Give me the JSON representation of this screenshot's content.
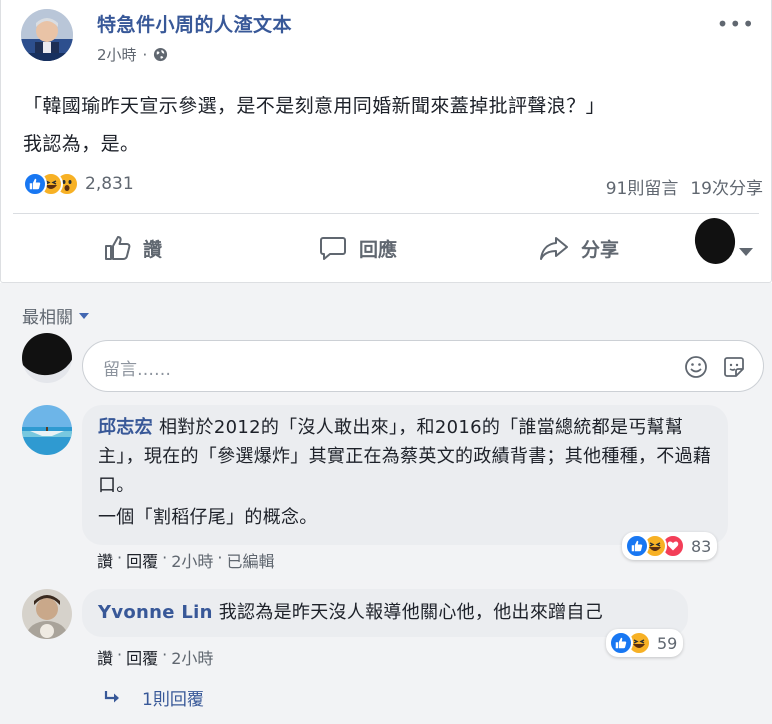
{
  "post": {
    "page_name": "特急件小周的人渣文本",
    "time": "2小時",
    "line1": "「韓國瑜昨天宣示參選，是不是刻意用同婚新聞來蓋掉批評聲浪？」",
    "line2": "我認為，是。",
    "reaction_count": "2,831",
    "comments_count": "91則留言",
    "shares_count": "19次分享",
    "reaction_icons": [
      "like-icon",
      "haha-icon",
      "wow-icon"
    ]
  },
  "actions": {
    "like": "讚",
    "comment": "回應",
    "share": "分享"
  },
  "sort_label": "最相關",
  "comment_input": {
    "placeholder": "留言……"
  },
  "comments": [
    {
      "author": "邱志宏",
      "text1": "相對於2012的「沒人敢出來」，和2016的「誰當總統都是丐幫幫主」，現在的「參選爆炸」其實正在為蔡英文的政績背書；其他種種，不過藉口。",
      "text2": "一個「割稻仔尾」的概念。",
      "like": "讚",
      "reply": "回覆",
      "time": "2小時",
      "edited": "已編輯",
      "reaction_count": "83",
      "reaction_icons": [
        "like-icon",
        "haha-icon",
        "love-icon"
      ]
    },
    {
      "author": "Yvonne Lin",
      "text": "我認為是昨天沒人報導他關心他，他出來蹭自己",
      "like": "讚",
      "reply": "回覆",
      "time": "2小時",
      "reaction_count": "59",
      "reaction_icons": [
        "like-icon",
        "haha-icon"
      ],
      "replies_link": "1則回覆"
    }
  ],
  "colors": {
    "link": "#385898",
    "like_blue": "#1877f2",
    "haha_yellow": "#f7b125",
    "love_red": "#f33e58"
  }
}
